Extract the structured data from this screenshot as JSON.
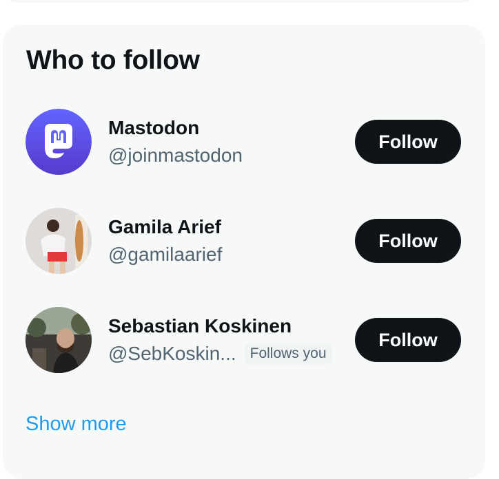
{
  "widget": {
    "title": "Who to follow",
    "show_more": "Show more"
  },
  "suggestions": [
    {
      "name": "Mastodon",
      "handle": "@joinmastodon",
      "button": "Follow",
      "avatar_icon": "mastodon-logo-icon"
    },
    {
      "name": "Gamila Arief",
      "handle": "@gamilaarief",
      "button": "Follow",
      "avatar_icon": "profile-photo"
    },
    {
      "name": "Sebastian Koskinen",
      "handle": "@SebKoskin...",
      "badge": "Follows you",
      "button": "Follow",
      "avatar_icon": "profile-photo"
    }
  ],
  "colors": {
    "card_background": "#f7f9f9",
    "button_background": "#0f1419",
    "link": "#1d9bf0",
    "secondary_text": "#536471",
    "mastodon_purple": "#6364ff"
  }
}
